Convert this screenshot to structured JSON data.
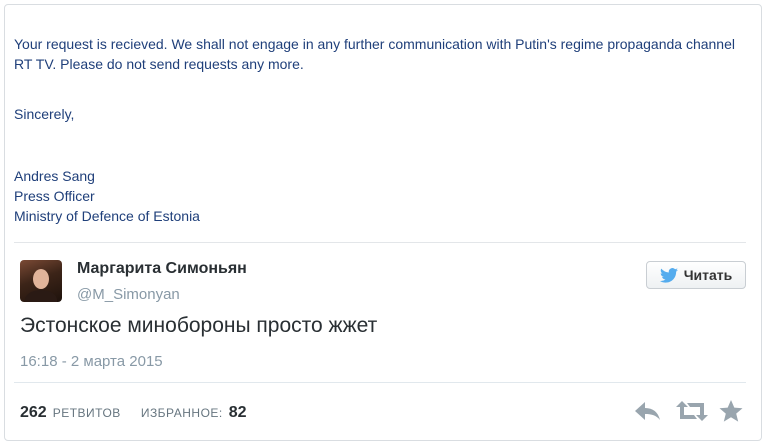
{
  "email": {
    "body": "Your request is recieved. We shall not engage in any further communication with Putin's regime propaganda channel RT TV. Please do not send requests any more.",
    "closing": "Sincerely,",
    "signature": {
      "name": "Andres Sang",
      "title": "Press Officer",
      "organization": "Ministry of Defence of Estonia"
    }
  },
  "tweet": {
    "author_name": "Маргарита Симоньян",
    "author_handle": "@M_Simonyan",
    "follow_label": "Читать",
    "text": "Эстонское минобороны просто жжет",
    "timestamp": "16:18 - 2 марта 2015",
    "retweets_count": "262",
    "retweets_label": "РЕТВИТОВ",
    "favorites_label": "ИЗБРАННОЕ:",
    "favorites_count": "82"
  },
  "icons": {
    "follow": "twitter-bird-icon",
    "reply": "reply-icon",
    "retweet": "retweet-icon",
    "favorite": "star-icon"
  },
  "colors": {
    "email_text": "#1f3f7a",
    "twitter_blue": "#55acee",
    "muted": "#8899a6"
  }
}
